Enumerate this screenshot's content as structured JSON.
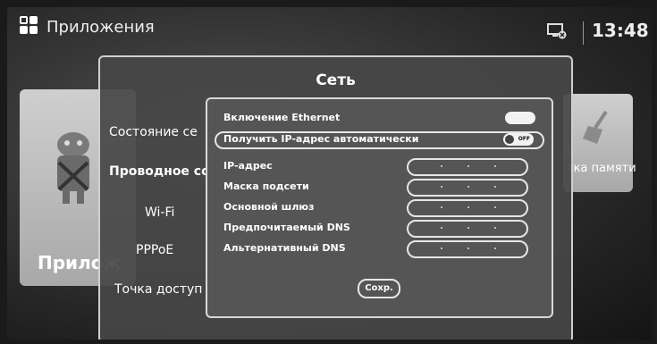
{
  "header": {
    "apps_title": "Приложения",
    "clock": "13:48",
    "icons": [
      "apps-grid-icon",
      "network-disconnected-icon"
    ]
  },
  "background": {
    "left_card_label": "Прилож",
    "right_card_label": "тка памяти"
  },
  "dialog": {
    "title": "Сеть",
    "menu": [
      {
        "label": "Состояние се",
        "selected": false
      },
      {
        "label": "Проводное со",
        "selected": true
      },
      {
        "label": "Wi-Fi",
        "selected": false
      },
      {
        "label": "PPPoE",
        "selected": false
      },
      {
        "label": "Точка доступ",
        "selected": false
      }
    ],
    "panel": {
      "ethernet_label": "Включение Ethernet",
      "ethernet_enabled": true,
      "auto_ip_label": "Получить IP-адрес автоматически",
      "auto_ip_toggle": "OFF",
      "fields": [
        {
          "label": "IP-адрес",
          "value": ". . ."
        },
        {
          "label": "Маска подсети",
          "value": ". . ."
        },
        {
          "label": "Основной шлюз",
          "value": ". . ."
        },
        {
          "label": "Предпочитаемый DNS",
          "value": ". . ."
        },
        {
          "label": "Альтернативный DNS",
          "value": ". . ."
        }
      ],
      "save_label": "Сохр."
    }
  }
}
